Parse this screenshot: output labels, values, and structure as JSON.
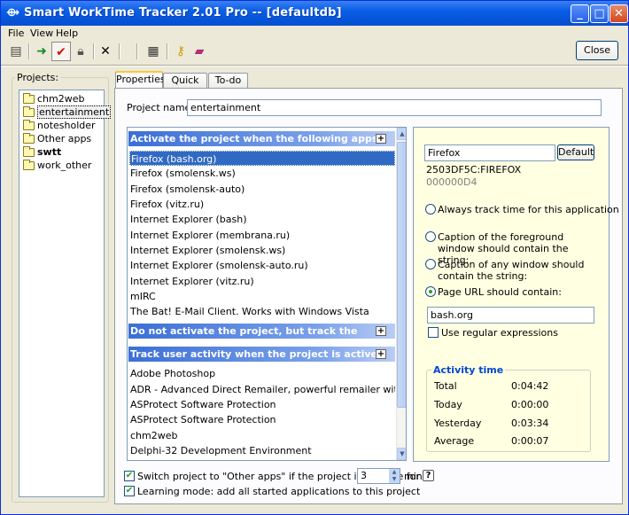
{
  "window": {
    "title": "Smart WorkTime Tracker 2.01 Pro -- [defaultdb]",
    "title_icon": "app-logo-icon"
  },
  "menu": {
    "file": "File",
    "view": "View",
    "help": "Help"
  },
  "toolbar": {
    "icons": [
      "new-project-icon",
      "arrow-right-icon",
      "checkmark-icon",
      "lock-icon",
      "delete-x-icon",
      "report-icon",
      "key-icon",
      "book-icon"
    ],
    "close_label": "Close"
  },
  "projects": {
    "label": "Projects:",
    "items": [
      {
        "name": "chm2web"
      },
      {
        "name": "entertainment"
      },
      {
        "name": "notesholder"
      },
      {
        "name": "Other apps"
      },
      {
        "name": "swtt"
      },
      {
        "name": "work_other"
      }
    ],
    "selected": "entertainment",
    "bold_item": "swtt"
  },
  "tabs": [
    {
      "label": "Properties"
    },
    {
      "label": "Quick info"
    },
    {
      "label": "To-do list"
    }
  ],
  "properties": {
    "project_name_label": "Project name:",
    "project_name_value": "entertainment"
  },
  "apps": {
    "section_activate": "Activate the project when the following apps active:",
    "activate_items": [
      "Firefox (bash.org)",
      "Firefox (smolensk.ws)",
      "Firefox (smolensk-auto)",
      "Firefox (vitz.ru)",
      "Internet Explorer (bash)",
      "Internet Explorer (membrana.ru)",
      "Internet Explorer (smolensk.ws)",
      "Internet Explorer (smolensk-auto.ru)",
      "Internet Explorer (vitz.ru)",
      "mIRC",
      "The Bat! E-Mail Client. Works with Windows Vista"
    ],
    "section_track": "Do not activate the project, but track the activity:",
    "section_user": "Track user activity when the project is active:",
    "user_items": [
      "Adobe Photoshop",
      "ADR - Advanced Direct Remailer, powerful remailer with SMTP server, su",
      "ASProtect Software Protection",
      "ASProtect Software Protection",
      "chm2web",
      "Delphi-32 Development Environment"
    ],
    "plus": "+"
  },
  "detail": {
    "app_name": "Firefox",
    "default_button": "Default",
    "id_line1": "2503DF5C:FIREFOX",
    "id_line2": "000000D4",
    "radio_always": "Always track time for this application",
    "radio_caption_fg": "Caption of the foreground window should contain the string:",
    "radio_caption_any": "Caption of any window should contain the string:",
    "radio_url": "Page URL should contain:",
    "url_value": "bash.org",
    "regex_label": "Use regular expressions"
  },
  "activity": {
    "label": "Activity time",
    "rows": [
      {
        "name": "Total",
        "value": "0:04:42"
      },
      {
        "name": "Today",
        "value": "0:00:00"
      },
      {
        "name": "Yesterday",
        "value": "0:03:34"
      },
      {
        "name": "Average",
        "value": "0:00:07"
      }
    ]
  },
  "bottom": {
    "switch_label": "Switch project to \"Other apps\" if the project is inactive for",
    "switch_value": "3",
    "min_label": "min",
    "help": "?",
    "learning_label": "Learning mode: add all started applications to this project"
  },
  "colors": {
    "selection": "#316ac5",
    "section_header": "#3b6fd6",
    "panel_bg": "#ffffe1",
    "accent_title": "#0046d5"
  }
}
